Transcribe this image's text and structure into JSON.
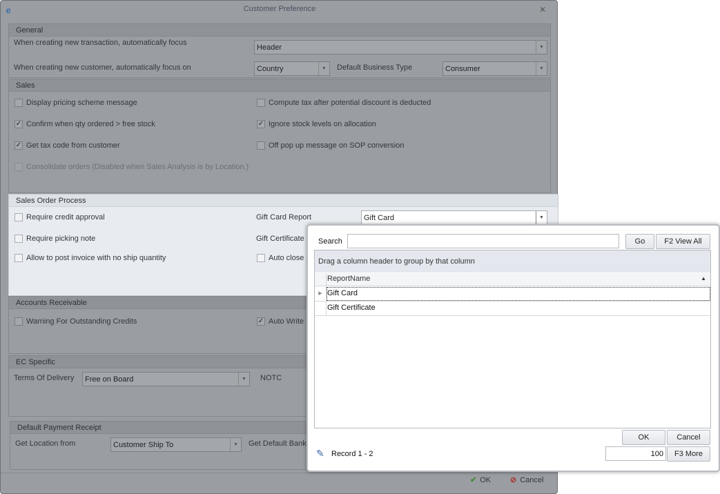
{
  "window": {
    "title": "Customer Preference",
    "close": "✕"
  },
  "general": {
    "title": "General",
    "new_txn_label": "When creating new transaction, automatically focus",
    "new_txn_value": "Header",
    "new_cust_label": "When creating new customer, automatically focus on",
    "new_cust_value": "Country",
    "biz_type_label": "Default Business Type",
    "biz_type_value": "Consumer"
  },
  "sales": {
    "title": "Sales",
    "items": [
      {
        "label": "Display pricing scheme message",
        "checked": false
      },
      {
        "label": "Compute tax after potential discount is deducted",
        "checked": false
      },
      {
        "label": "Confirm when qty ordered > free stock",
        "checked": true
      },
      {
        "label": "Ignore stock levels on allocation",
        "checked": true
      },
      {
        "label": "Get tax code from customer",
        "checked": true
      },
      {
        "label": "Off pop up message on SOP conversion",
        "checked": false
      },
      {
        "label": "Consolidate orders (Disabled when Sales Analysis is by Location.)",
        "checked": false
      }
    ]
  },
  "sop": {
    "title": "Sales Order Process",
    "items": [
      {
        "label": "Require credit approval",
        "checked": false
      },
      {
        "label": "Require picking note",
        "checked": false
      },
      {
        "label": "Allow to post invoice with no ship quantity",
        "checked": false
      },
      {
        "label": "Auto close s",
        "checked": false
      }
    ],
    "gift_card_label": "Gift Card Report",
    "gift_card_value": "Gift Card",
    "gift_cert_label": "Gift Certificate"
  },
  "ar": {
    "title": "Accounts Receivable",
    "items": [
      {
        "label": "Warning For Outstanding Credits",
        "checked": false
      },
      {
        "label": "Auto Write",
        "checked": true
      }
    ]
  },
  "ec": {
    "title": "EC Specific",
    "terms_label": "Terms Of Delivery",
    "terms_value": "Free on Board",
    "notc_label": "NOTC"
  },
  "payment": {
    "title": "Default Payment Receipt",
    "location_label": "Get Location from",
    "location_value": "Customer Ship To",
    "bank_label": "Get Default Bank"
  },
  "footer": {
    "ok": "OK",
    "cancel": "Cancel"
  },
  "lookup": {
    "search_label": "Search",
    "search_value": "",
    "go": "Go",
    "view_all": "F2 View All",
    "group_hint": "Drag a column header to group by that column",
    "column": "ReportName",
    "rows": [
      "Gift Card",
      "Gift Certificate"
    ],
    "ok": "OK",
    "cancel": "Cancel",
    "record": "Record 1 - 2",
    "page_size": "100",
    "more": "F3 More"
  }
}
